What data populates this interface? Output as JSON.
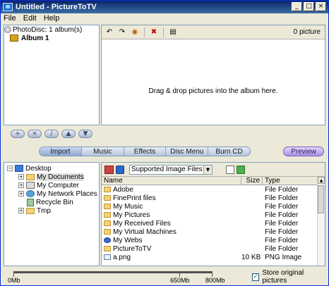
{
  "window": {
    "title": "Untitled - PictureToTV"
  },
  "titlebar_buttons": {
    "minimize": "_",
    "maximize": "□",
    "close": "×"
  },
  "menu": [
    "File",
    "Edit",
    "Help"
  ],
  "album_tree": {
    "root": "PhotoDisc: 1 album(s)",
    "album": "Album 1"
  },
  "album_controls": [
    "+",
    "×",
    "/",
    "▲",
    "▼"
  ],
  "drop_area": {
    "picture_count": "0 picture",
    "hint": "Drag & drop pictures into the album here."
  },
  "tabs": [
    "Import",
    "Music",
    "Effects",
    "Disc Menu",
    "Burn CD"
  ],
  "active_tab": "Import",
  "preview_label": "Preview",
  "folder_tree": {
    "desktop": "Desktop",
    "items": [
      "My Documents",
      "My Computer",
      "My Network Places",
      "Recycle Bin",
      "Tmp"
    ]
  },
  "file_browser": {
    "filter": "Supported Image Files",
    "columns": {
      "name": "Name",
      "size": "Size",
      "type": "Type"
    },
    "rows": [
      {
        "name": "Adobe",
        "size": "",
        "type": "File Folder"
      },
      {
        "name": "FinePrint files",
        "size": "",
        "type": "File Folder"
      },
      {
        "name": "My Music",
        "size": "",
        "type": "File Folder"
      },
      {
        "name": "My Pictures",
        "size": "",
        "type": "File Folder"
      },
      {
        "name": "My Received Files",
        "size": "",
        "type": "File Folder"
      },
      {
        "name": "My Virtual Machines",
        "size": "",
        "type": "File Folder"
      },
      {
        "name": "My Webs",
        "size": "",
        "type": "File Folder"
      },
      {
        "name": "PictureToTV",
        "size": "",
        "type": "File Folder"
      },
      {
        "name": "a.png",
        "size": "10 KB",
        "type": "PNG Image"
      }
    ]
  },
  "capacity": {
    "start": "0Mb",
    "mark1": "650Mb",
    "mark2": "800Mb"
  },
  "store_original": {
    "label": "Store original pictures",
    "checked": "✓"
  }
}
